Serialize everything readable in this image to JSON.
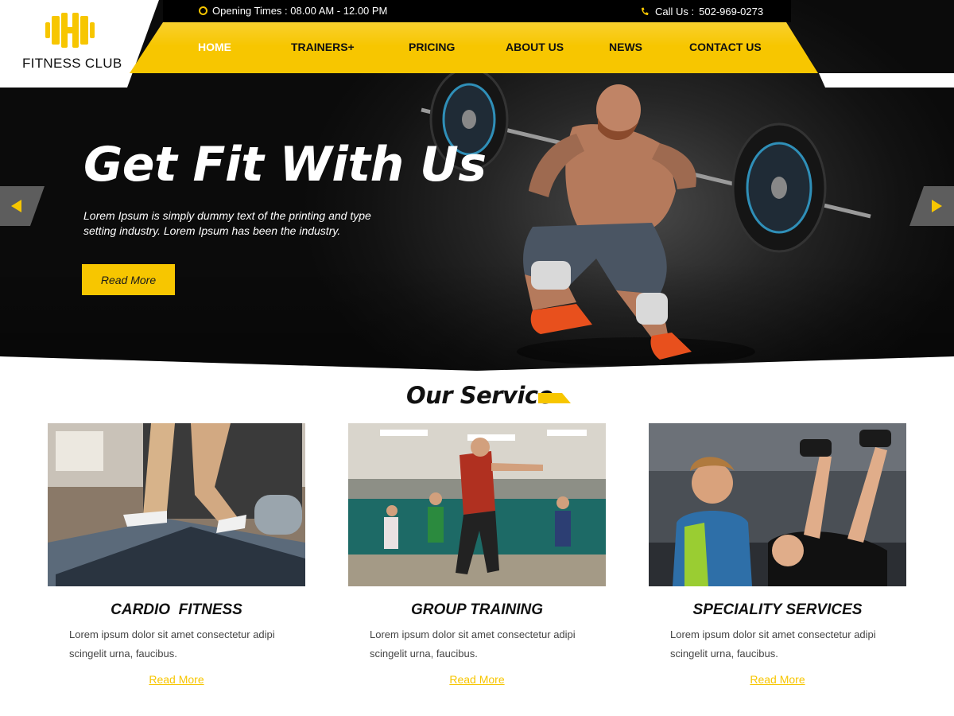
{
  "brand": {
    "name": "FITNESS CLUB",
    "accent_color": "#f7c600",
    "logo_icon": "dumbbell-h-icon"
  },
  "topbar": {
    "hours": "Opening Times : 08.00 AM - 12.00 PM",
    "phone_label": "Call Us :",
    "phone_number": "502-969-0273",
    "clock_icon": "clock-icon",
    "phone_icon": "phone-icon"
  },
  "nav": {
    "items": [
      "HOME",
      "TRAINERS+",
      "PRICING",
      "ABOUT US",
      "NEWS",
      "CONTACT US"
    ],
    "active": "HOME"
  },
  "hero": {
    "title": "Get Fit With Us",
    "text": "Lorem Ipsum is simply dummy text of the printing and type setting industry. Lorem Ipsum has been the industry.",
    "button": "Read More",
    "prev_icon": "arrow-left-icon",
    "next_icon": "arrow-right-icon"
  },
  "services": {
    "title": "Our Service",
    "cards": [
      {
        "title": "CARDIO  FITNESS",
        "text": "Lorem ipsum dolor sit amet consectetur adipi scingelit urna, faucibus.",
        "link": "Read More"
      },
      {
        "title": "GROUP TRAINING",
        "text": "Lorem ipsum dolor sit amet consectetur adipi scingelit urna, faucibus.",
        "link": "Read More"
      },
      {
        "title": "SPECIALITY SERVICES",
        "text": "Lorem ipsum dolor sit amet consectetur adipi scingelit urna, faucibus.",
        "link": "Read More"
      }
    ]
  }
}
